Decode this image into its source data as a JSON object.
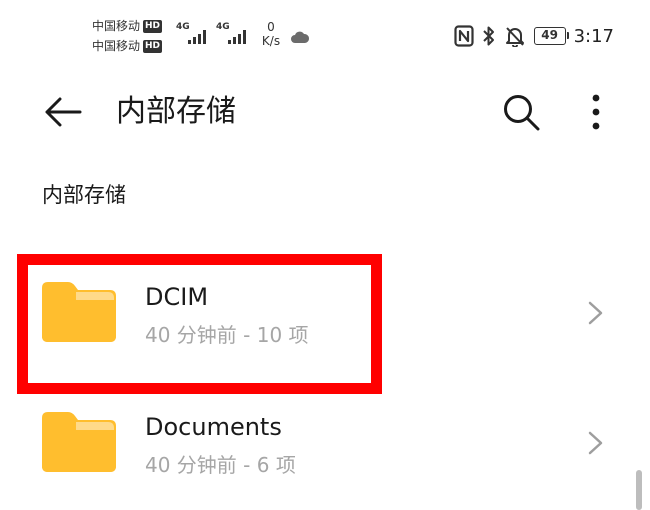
{
  "status_bar": {
    "carrier_1": "中国移动",
    "carrier_2": "中国移动",
    "hd_label": "HD",
    "network_1": "4G",
    "network_2": "4G",
    "speed_value": "0",
    "speed_unit": "K/s",
    "battery": "49",
    "time": "3:17",
    "icons": [
      "nfc-icon",
      "bluetooth-icon",
      "mute-icon",
      "cloud-icon"
    ]
  },
  "toolbar": {
    "title": "内部存储",
    "icons": [
      "back-arrow-icon",
      "search-icon",
      "more-vertical-icon"
    ]
  },
  "breadcrumb": "内部存储",
  "folders": [
    {
      "name": "DCIM",
      "meta": "40 分钟前 - 10 项",
      "highlighted": true
    },
    {
      "name": "Documents",
      "meta": "40 分钟前 - 6 项",
      "highlighted": false
    }
  ],
  "colors": {
    "folder_body": "#FFBE2E",
    "folder_tab": "#FFDA8A",
    "secondary_text": "#A6A6A6",
    "highlight": "#FF0000",
    "chevron": "#9E9E9E"
  }
}
